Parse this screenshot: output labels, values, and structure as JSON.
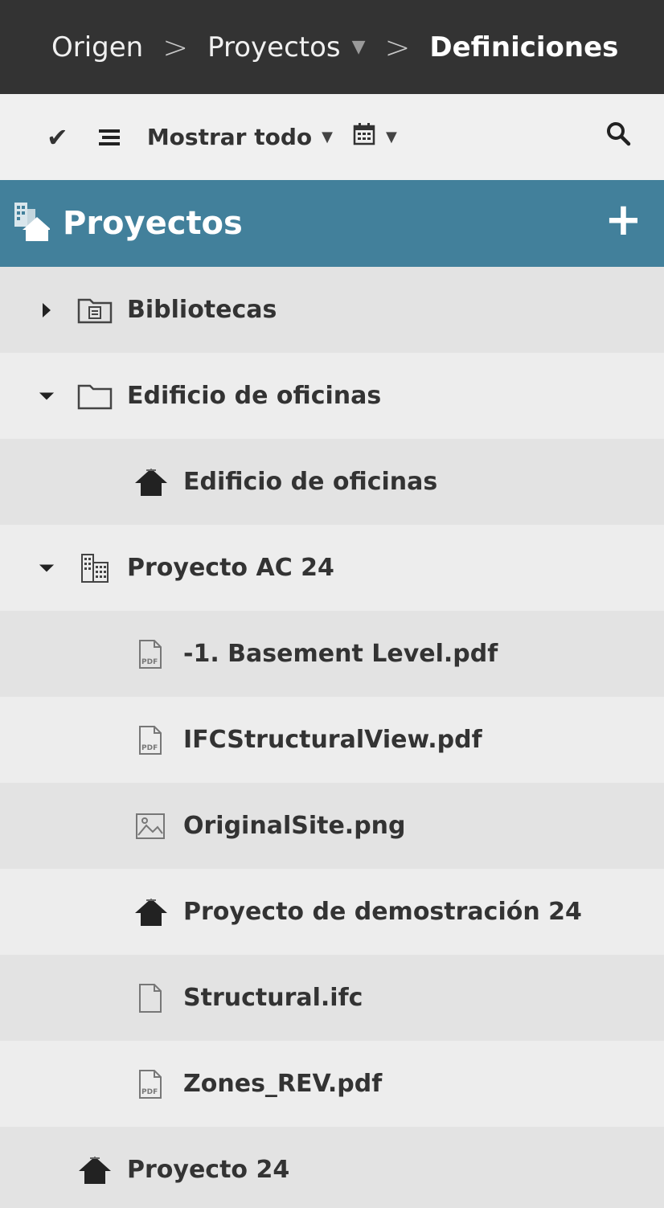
{
  "breadcrumb": {
    "items": [
      "Origen",
      "Proyectos",
      "Definiciones"
    ]
  },
  "toolbar": {
    "filter_label": "Mostrar todo"
  },
  "panel": {
    "title": "Proyectos"
  },
  "tree": {
    "items": [
      {
        "label": "Bibliotecas",
        "icon": "library-folder-icon",
        "expanded": false
      },
      {
        "label": "Edificio de oficinas",
        "icon": "folder-icon",
        "expanded": true
      },
      {
        "label": "Edificio de oficinas",
        "icon": "project-house-icon"
      },
      {
        "label": "Proyecto AC 24",
        "icon": "building-icon",
        "expanded": true
      },
      {
        "label": "-1. Basement Level.pdf",
        "icon": "pdf-file-icon"
      },
      {
        "label": "IFCStructuralView.pdf",
        "icon": "pdf-file-icon"
      },
      {
        "label": "OriginalSite.png",
        "icon": "image-file-icon"
      },
      {
        "label": "Proyecto de demostración 24",
        "icon": "project-house-icon"
      },
      {
        "label": "Structural.ifc",
        "icon": "file-icon"
      },
      {
        "label": "Zones_REV.pdf",
        "icon": "pdf-file-icon"
      },
      {
        "label": "Proyecto 24",
        "icon": "project-house-icon"
      }
    ]
  },
  "colors": {
    "breadcrumb_bg": "#333333",
    "header_bg": "#42809b",
    "row_alt": "#e3e3e3",
    "row_plain": "#ededed"
  }
}
